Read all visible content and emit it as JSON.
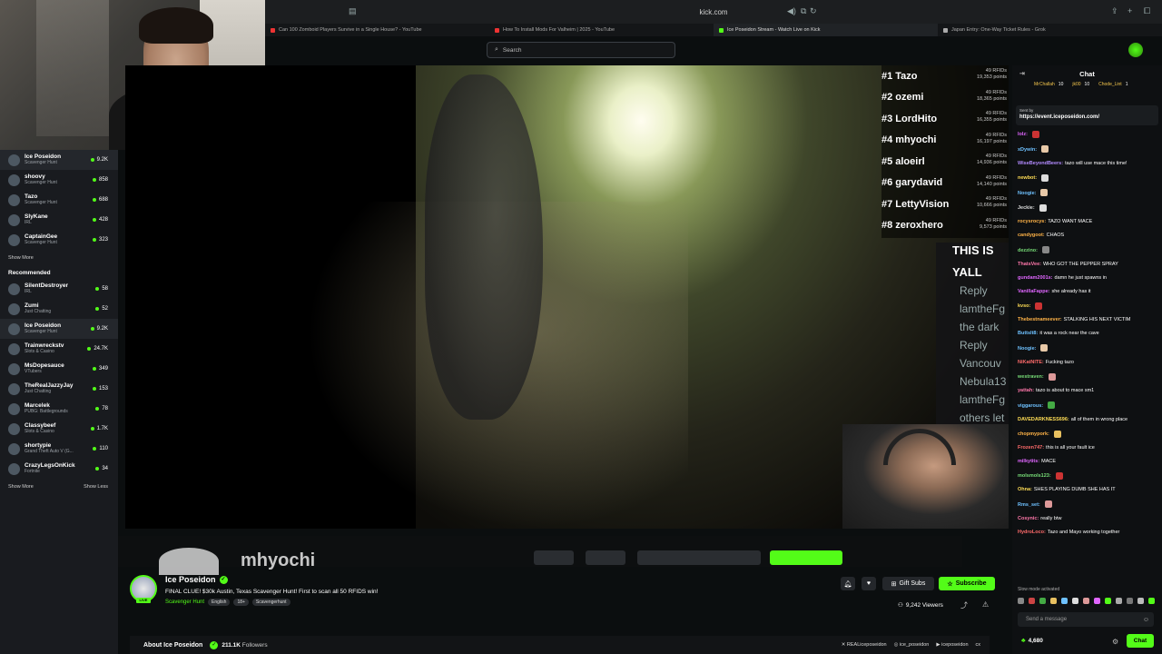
{
  "browser": {
    "url": "kick.com",
    "tabs": [
      {
        "title": "Can 100 Zomboid Players Survive in a Single House? - YouTube",
        "color": "#e33",
        "active": false
      },
      {
        "title": "How To Install Mods For Valheim | 2025 - YouTube",
        "color": "#e33",
        "active": false
      },
      {
        "title": "Ice Poseidon Stream - Watch Live on Kick",
        "color": "#53fc18",
        "active": true
      },
      {
        "title": "Japan Entry: One-Way Ticket Rules - Grok",
        "color": "#aaa",
        "active": false
      }
    ]
  },
  "search": {
    "placeholder": "Search",
    "icon": "search-icon"
  },
  "sidebar": {
    "following": [
      {
        "name": "Ice Poseidon",
        "sub": "Scavenger Hunt",
        "count": "9.2K",
        "active": true
      },
      {
        "name": "shoovy",
        "sub": "Scavenger Hunt",
        "count": "858",
        "active": false
      },
      {
        "name": "Tazo",
        "sub": "Scavenger Hunt",
        "count": "688",
        "active": false
      },
      {
        "name": "SlyKane",
        "sub": "IRL",
        "count": "428",
        "active": false
      },
      {
        "name": "CaptainGee",
        "sub": "Scavenger Hunt",
        "count": "323",
        "active": false
      }
    ],
    "show_more_1": "Show More",
    "recommended_title": "Recommended",
    "recommended": [
      {
        "name": "SilentDestroyer",
        "sub": "IRL",
        "count": "58",
        "active": false
      },
      {
        "name": "Zumi",
        "sub": "Just Chatting",
        "count": "52",
        "active": false
      },
      {
        "name": "Ice Poseidon",
        "sub": "Scavenger Hunt",
        "count": "9.2K",
        "active": true
      },
      {
        "name": "Trainwreckstv",
        "sub": "Slots & Casino",
        "count": "24.7K",
        "active": false
      },
      {
        "name": "MsDopesauce",
        "sub": "VTubers",
        "count": "349",
        "active": false
      },
      {
        "name": "TheRealJazzyJay",
        "sub": "Just Chatting",
        "count": "153",
        "active": false
      },
      {
        "name": "Marcelek",
        "sub": "PUBG: Battlegrounds",
        "count": "78",
        "active": false
      },
      {
        "name": "Classybeef",
        "sub": "Slots & Casino",
        "count": "1.7K",
        "active": false
      },
      {
        "name": "shortypie",
        "sub": "Grand Theft Auto V (G...",
        "count": "110",
        "active": false
      },
      {
        "name": "CrazyLegsOnKick",
        "sub": "Fortnite",
        "count": "34",
        "active": false
      }
    ],
    "show_more_2": "Show More",
    "show_less": "Show Less"
  },
  "video": {
    "leaderboard": [
      {
        "rank": "#1",
        "name": "Tazo",
        "rfids": "49 RFIDs",
        "points": "19,353 points"
      },
      {
        "rank": "#2",
        "name": "ozemi",
        "rfids": "49 RFIDs",
        "points": "18,365 points"
      },
      {
        "rank": "#3",
        "name": "LordHito",
        "rfids": "49 RFIDs",
        "points": "16,355 points"
      },
      {
        "rank": "#4",
        "name": "mhyochi",
        "rfids": "49 RFIDs",
        "points": "16,197 points"
      },
      {
        "rank": "#5",
        "name": "aloeirl",
        "rfids": "49 RFIDs",
        "points": "14,936 points"
      },
      {
        "rank": "#6",
        "name": "garydavid",
        "rfids": "49 RFIDs",
        "points": "14,140 points"
      },
      {
        "rank": "#7",
        "name": "LettyVision",
        "rfids": "49 RFIDs",
        "points": "10,666 points"
      },
      {
        "rank": "#8",
        "name": "zeroxhero",
        "rfids": "49 RFIDs",
        "points": "9,573 points"
      }
    ],
    "overlay_lines": [
      "THIS IS",
      "YALL"
    ],
    "overlay_chat": [
      "Reply",
      "lamtheFg",
      "the dark",
      "Reply",
      "Vancouv",
      "Nebula13",
      "lamtheFg",
      "others let",
      "Reply"
    ],
    "cut_name": "mhyochi"
  },
  "stream": {
    "streamer": "Ice Poseidon",
    "live_label": "LIVE",
    "title": "FINAL CLUE! $30k Austin, Texas Scavenger Hunt! First to scan all 50 RFIDS win!",
    "category": "Scavenger Hunt",
    "tags": [
      "English",
      "18+",
      "Scavengerhunt"
    ],
    "gift_subs": "Gift Subs",
    "subscribe": "Subscribe",
    "viewers": "9,242 Viewers",
    "about_label": "About Ice Poseidon",
    "followers_count": "211.1K",
    "followers_label": "Followers",
    "socials": [
      "REALiceposeidon",
      "ice_poseidon",
      "iceposeidon",
      "cx"
    ]
  },
  "chat": {
    "header": "Chat",
    "gifters": [
      {
        "name": "MrChallah",
        "count": "10"
      },
      {
        "name": "jk00",
        "count": "10"
      },
      {
        "name": "Chode_Lint",
        "count": "1"
      }
    ],
    "pinned_sent_by": "Sent by",
    "pinned_link": "https://event.iceposeidon.com/",
    "messages": [
      {
        "user": "lolz:",
        "text": "",
        "color": "#e066ff",
        "emote": "#c33"
      },
      {
        "user": "xDywin:",
        "text": "",
        "color": "#6ec1ff",
        "emote": "#e8c9a8"
      },
      {
        "user": "WiseBeyondBeers:",
        "text": "tazo will use mace this time!",
        "color": "#b38bff",
        "emote": ""
      },
      {
        "user": "newbot:",
        "text": "",
        "color": "#ffdd55",
        "emote": "#ddd"
      },
      {
        "user": "Noogie:",
        "text": "",
        "color": "#6ec1ff",
        "emote": "#e8c9a8"
      },
      {
        "user": "Jeckie:",
        "text": "",
        "color": "#ddd",
        "emote": "#ddd"
      },
      {
        "user": "rocysrocys:",
        "text": "TAZO WANT MACE",
        "color": "#ffb347",
        "emote": ""
      },
      {
        "user": "candygoot:",
        "text": "CHAOS",
        "color": "#ffb347",
        "emote": ""
      },
      {
        "user": "dezzino:",
        "text": "",
        "color": "#77dd77",
        "emote": "#888"
      },
      {
        "user": "ThatsVee:",
        "text": "WHO GOT THE PEPPER SPRAY",
        "color": "#ff77aa",
        "emote": ""
      },
      {
        "user": "gundam2001s:",
        "text": "damn he just spawns in",
        "color": "#e066ff",
        "emote": ""
      },
      {
        "user": "VanillaFappe:",
        "text": "she already has it",
        "color": "#e066ff",
        "emote": ""
      },
      {
        "user": "kvso:",
        "text": "",
        "color": "#ffdd55",
        "emote": "#c33"
      },
      {
        "user": "Thebestnameever:",
        "text": "STALKING HIS NEXT VICTIM",
        "color": "#ffb347",
        "emote": ""
      },
      {
        "user": "Buttslt8:",
        "text": "it was a rock near the cave",
        "color": "#6ec1ff",
        "emote": ""
      },
      {
        "user": "Noogie:",
        "text": "",
        "color": "#6ec1ff",
        "emote": "#e8c9a8"
      },
      {
        "user": "NiKatNITE:",
        "text": "Fucking tazo",
        "color": "#ff6b6b",
        "emote": ""
      },
      {
        "user": "westraven:",
        "text": "",
        "color": "#77dd77",
        "emote": "#d99"
      },
      {
        "user": "yattah:",
        "text": "tazo is about to mace sm1",
        "color": "#ff77aa",
        "emote": ""
      },
      {
        "user": "viggarous:",
        "text": "",
        "color": "#6ec1ff",
        "emote": "#4a4"
      },
      {
        "user": "DAVEDARKNESS696:",
        "text": "all of them in wrong place",
        "color": "#ffdd55",
        "emote": ""
      },
      {
        "user": "chopmypork:",
        "text": "",
        "color": "#ffb347",
        "emote": "#e8c060"
      },
      {
        "user": "Frozen747:",
        "text": "this is all your fault ice",
        "color": "#ff6b6b",
        "emote": ""
      },
      {
        "user": "milkytits:",
        "text": "MACE",
        "color": "#e066ff",
        "emote": ""
      },
      {
        "user": "molsmols123:",
        "text": "",
        "color": "#77dd77",
        "emote": "#c33"
      },
      {
        "user": "Ohna:",
        "text": "SHES PLAYING DUMB SHE HAS IT",
        "color": "#ffdd55",
        "emote": ""
      },
      {
        "user": "Rms_set:",
        "text": "",
        "color": "#6ec1ff",
        "emote": "#d99"
      },
      {
        "user": "Cosynic:",
        "text": "really btw",
        "color": "#ff77aa",
        "emote": ""
      },
      {
        "user": "HydroLoco:",
        "text": "Tazo and Mayo working together",
        "color": "#ff6b6b",
        "emote": ""
      }
    ],
    "slow_mode": "Slow mode activated",
    "input_placeholder": "Send a message",
    "points": "4,680",
    "send": "Chat"
  }
}
